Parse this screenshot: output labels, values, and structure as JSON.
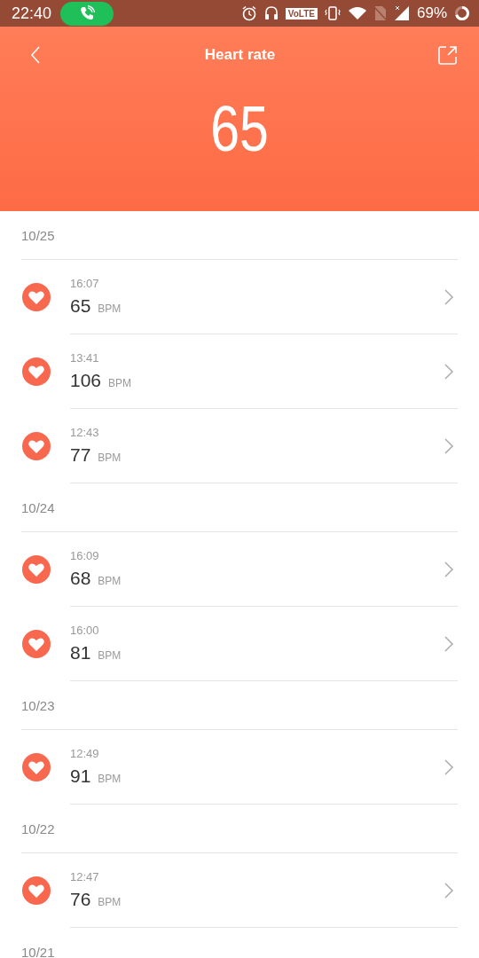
{
  "status_bar": {
    "time": "22:40",
    "volte": "VoLTE",
    "battery": "69%"
  },
  "header": {
    "title": "Heart rate",
    "value": "65"
  },
  "groups": [
    {
      "date": "10/25",
      "entries": [
        {
          "time": "16:07",
          "value": "65",
          "unit": "BPM"
        },
        {
          "time": "13:41",
          "value": "106",
          "unit": "BPM"
        },
        {
          "time": "12:43",
          "value": "77",
          "unit": "BPM"
        }
      ]
    },
    {
      "date": "10/24",
      "entries": [
        {
          "time": "16:09",
          "value": "68",
          "unit": "BPM"
        },
        {
          "time": "16:00",
          "value": "81",
          "unit": "BPM"
        }
      ]
    },
    {
      "date": "10/23",
      "entries": [
        {
          "time": "12:49",
          "value": "91",
          "unit": "BPM"
        }
      ]
    },
    {
      "date": "10/22",
      "entries": [
        {
          "time": "12:47",
          "value": "76",
          "unit": "BPM"
        }
      ]
    },
    {
      "date": "10/21"
    }
  ]
}
